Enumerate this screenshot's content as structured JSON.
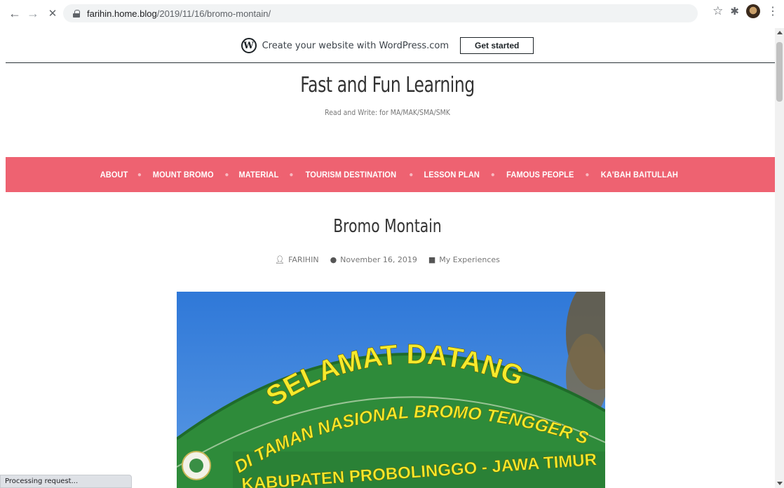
{
  "browser": {
    "back_glyph": "←",
    "forward_glyph": "→",
    "stop_glyph": "✕",
    "url_host": "farihin.home.blog",
    "url_path": "/2019/11/16/bromo-montain/",
    "icons": [
      "back-icon",
      "forward-icon",
      "stop-icon",
      "lock-icon",
      "star-icon",
      "extensions-icon",
      "profile-avatar",
      "menu-icon"
    ]
  },
  "wp_banner": {
    "text": "Create your website with WordPress.com",
    "button_label": "Get started",
    "logo_letter": "W"
  },
  "site": {
    "title": "Fast and Fun Learning",
    "description": "Read and Write: for MA/MAK/SMA/SMK"
  },
  "menu": {
    "items": [
      {
        "label": "ABOUT"
      },
      {
        "label": "MOUNT BROMO"
      },
      {
        "label": "MATERIAL"
      },
      {
        "label": "TOURISM DESTINATION"
      },
      {
        "label": "LESSON PLAN"
      },
      {
        "label": "FAMOUS PEOPLE"
      },
      {
        "label": "KA'BAH BAITULLAH"
      }
    ],
    "background": "#ee6271"
  },
  "post": {
    "title": "Bromo Montain",
    "author": "FARIHIN",
    "date": "November 16, 2019",
    "category": "My Experiences"
  },
  "hero_image": {
    "line1": "SELAMAT DATANG",
    "line2": "DI TAMAN NASIONAL BROMO TENGGER SEMERU",
    "line3": "KABUPATEN PROBOLINGGO - JAWA TIMUR"
  },
  "status": {
    "text": "Processing request..."
  }
}
